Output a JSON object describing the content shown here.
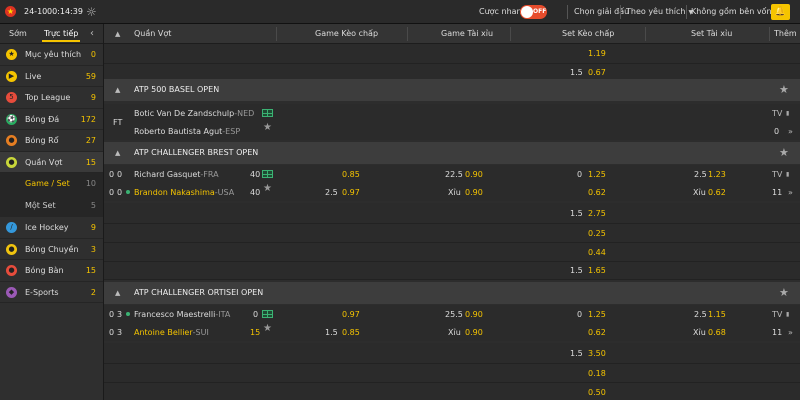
{
  "topbar": {
    "date": "24-10",
    "time": "00:14:39",
    "quick_bet_label": "Cược nhanh",
    "toggle_text": "OFF",
    "choose_league": "Chọn giải đấu",
    "sort_label": "Theo yêu thích",
    "filter_label": "Không gồm bên vốn"
  },
  "sidebar": {
    "tab_early": "Sớm",
    "tab_live": "Trực tiếp",
    "items": [
      {
        "label": "Mục yêu thích",
        "count": "0",
        "icon": "star-icon",
        "color": "#f5c400"
      },
      {
        "label": "Live",
        "count": "59",
        "icon": "live-tv-icon",
        "color": "#f5c400"
      },
      {
        "label": "Top League",
        "count": "9",
        "icon": "top-league-icon",
        "color": "#e74c3c"
      },
      {
        "label": "Bóng Đá",
        "count": "172",
        "icon": "soccer-ball-icon",
        "color": "#27ae60"
      },
      {
        "label": "Bóng Rổ",
        "count": "27",
        "icon": "basketball-icon",
        "color": "#e67e22"
      },
      {
        "label": "Quần Vợt",
        "count": "15",
        "icon": "tennis-ball-icon",
        "color": "#c8d63a"
      }
    ],
    "subitems": [
      {
        "label": "Game / Set",
        "count": "10"
      },
      {
        "label": "Một Set",
        "count": "5"
      }
    ],
    "items2": [
      {
        "label": "Ice Hockey",
        "count": "9",
        "icon": "ice-hockey-icon",
        "color": "#3498db"
      },
      {
        "label": "Bóng Chuyền",
        "count": "3",
        "icon": "volleyball-icon",
        "color": "#f1c40f"
      },
      {
        "label": "Bóng Bàn",
        "count": "15",
        "icon": "table-tennis-icon",
        "color": "#e74c3c"
      },
      {
        "label": "E-Sports",
        "count": "2",
        "icon": "esports-icon",
        "color": "#9b59b6"
      }
    ]
  },
  "columns": {
    "team": "Quần Vợt",
    "handicap_game": "Game Kèo chấp",
    "ou_game": "Game Tài xỉu",
    "handicap_set": "Set Kèo chấp",
    "ou_set": "Set Tài xỉu",
    "more": "Thêm"
  },
  "top_rows": [
    {
      "set_line": "",
      "set_odds": "1.19"
    },
    {
      "set_line": "1.5",
      "set_odds": "0.67"
    }
  ],
  "leagues": [
    {
      "name": "ATP 500 BASEL OPEN",
      "match": {
        "status": "FT",
        "home": "Botic Van De Zandschulp",
        "home_country": "-NED",
        "away": "Roberto Bautista Agut",
        "away_country": "-ESP",
        "tv": "TV",
        "more_count": "0"
      }
    },
    {
      "name": "ATP CHALLENGER BREST OPEN",
      "match": {
        "home_sets": "0",
        "home_games": "0",
        "away_sets": "0",
        "away_games": "0",
        "home": "Richard Gasquet",
        "home_country": "-FRA",
        "home_points": "40",
        "away": "Brandon Nakashima",
        "away_country": "-USA",
        "away_points": "40",
        "hg_line1": "",
        "hg_odds1": "0.85",
        "hg_line2": "2.5",
        "hg_odds2": "0.97",
        "og_line1": "22.5",
        "og_odds1": "0.90",
        "og_line2": "Xỉu",
        "og_odds2": "0.90",
        "hs_line1": "0",
        "hs_odds1": "1.25",
        "hs_line2": "",
        "hs_odds2": "0.62",
        "os_line1": "2.5",
        "os_odds1": "1.23",
        "os_line2": "Xỉu",
        "os_odds2": "0.62",
        "tv": "TV",
        "more_count": "11"
      },
      "extra": [
        {
          "line": "1.5",
          "odds": "2.75"
        },
        {
          "line": "",
          "odds": "0.25"
        },
        {
          "line": "",
          "odds": "0.44"
        },
        {
          "line": "1.5",
          "odds": "1.65"
        }
      ]
    },
    {
      "name": "ATP CHALLENGER ORTISEI OPEN",
      "match": {
        "home_sets": "0",
        "home_games": "3",
        "away_sets": "0",
        "away_games": "3",
        "home": "Francesco Maestrelli",
        "home_country": "-ITA",
        "home_points": "0",
        "away": "Antoine Bellier",
        "away_country": "-SUI",
        "away_points": "15",
        "hg_line1": "",
        "hg_odds1": "0.97",
        "hg_line2": "1.5",
        "hg_odds2": "0.85",
        "og_line1": "25.5",
        "og_odds1": "0.90",
        "og_line2": "Xỉu",
        "og_odds2": "0.90",
        "hs_line1": "0",
        "hs_odds1": "1.25",
        "hs_line2": "",
        "hs_odds2": "0.62",
        "os_line1": "2.5",
        "os_odds1": "1.15",
        "os_line2": "Xỉu",
        "os_odds2": "0.68",
        "tv": "TV",
        "more_count": "11"
      },
      "extra": [
        {
          "line": "1.5",
          "odds": "3.50"
        },
        {
          "line": "",
          "odds": "0.18"
        },
        {
          "line": "",
          "odds": "0.50"
        }
      ]
    }
  ]
}
